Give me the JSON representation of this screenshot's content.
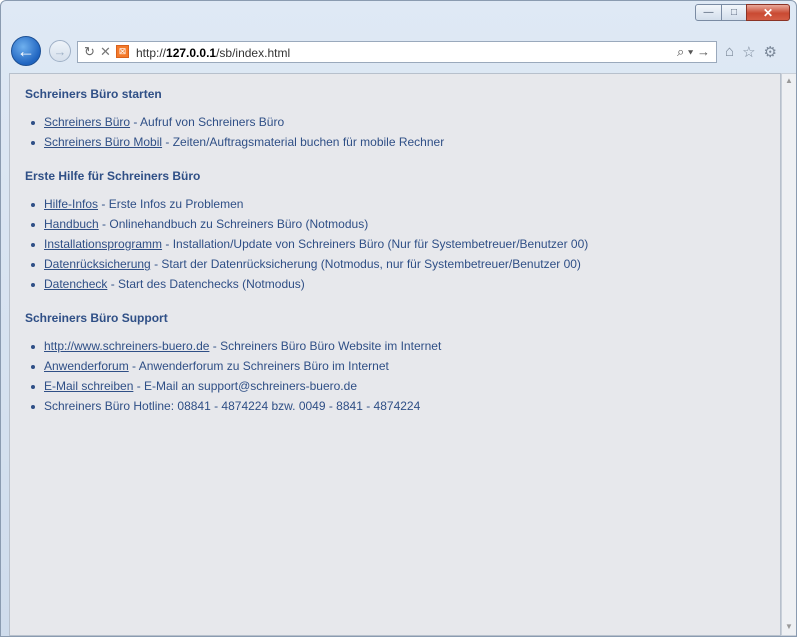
{
  "window": {
    "controls": {
      "minimize": "—",
      "maximize": "□",
      "close": "✕"
    }
  },
  "navbar": {
    "url_prefix": "http://",
    "url_host": "127.0.0.1",
    "url_path": "/sb/index.html",
    "tools": "⌕ ▾ →"
  },
  "sections": [
    {
      "heading": "Schreiners Büro starten",
      "items": [
        {
          "link": "Schreiners Büro",
          "text": " - Aufruf von Schreiners Büro"
        },
        {
          "link": "Schreiners Büro Mobil",
          "text": " - Zeiten/Auftragsmaterial buchen für mobile Rechner"
        }
      ]
    },
    {
      "heading": "Erste Hilfe für Schreiners Büro",
      "items": [
        {
          "link": "Hilfe-Infos",
          "text": " - Erste Infos zu Problemen"
        },
        {
          "link": "Handbuch",
          "text": " - Onlinehandbuch zu Schreiners Büro (Notmodus)"
        },
        {
          "link": "Installationsprogramm",
          "text": " - Installation/Update von Schreiners Büro (Nur für Systembetreuer/Benutzer 00)"
        },
        {
          "link": "Datenrücksicherung",
          "text": " - Start der Datenrücksicherung (Notmodus, nur für Systembetreuer/Benutzer 00)"
        },
        {
          "link": "Datencheck",
          "text": " - Start des Datenchecks (Notmodus)"
        }
      ]
    },
    {
      "heading": "Schreiners Büro Support",
      "items": [
        {
          "link": "http://www.schreiners-buero.de",
          "text": " - Schreiners Büro Büro Website im Internet"
        },
        {
          "link": "Anwenderforum",
          "text": " - Anwenderforum zu Schreiners Büro im Internet"
        },
        {
          "link": "E-Mail schreiben",
          "text": " - E-Mail an support@schreiners-buero.de"
        },
        {
          "link": "",
          "text": "Schreiners Büro Hotline: 08841 - 4874224 bzw. 0049 - 8841 - 4874224"
        }
      ]
    }
  ],
  "colors": {
    "text": "#2f4f86",
    "background": "#e7e8ec",
    "accent": "#1f64c0"
  },
  "icons": [
    "back-icon",
    "forward-icon",
    "reload-icon",
    "stop-icon",
    "favicon-icon",
    "search-icon",
    "home-icon",
    "favorites-star-icon",
    "settings-gear-icon"
  ]
}
